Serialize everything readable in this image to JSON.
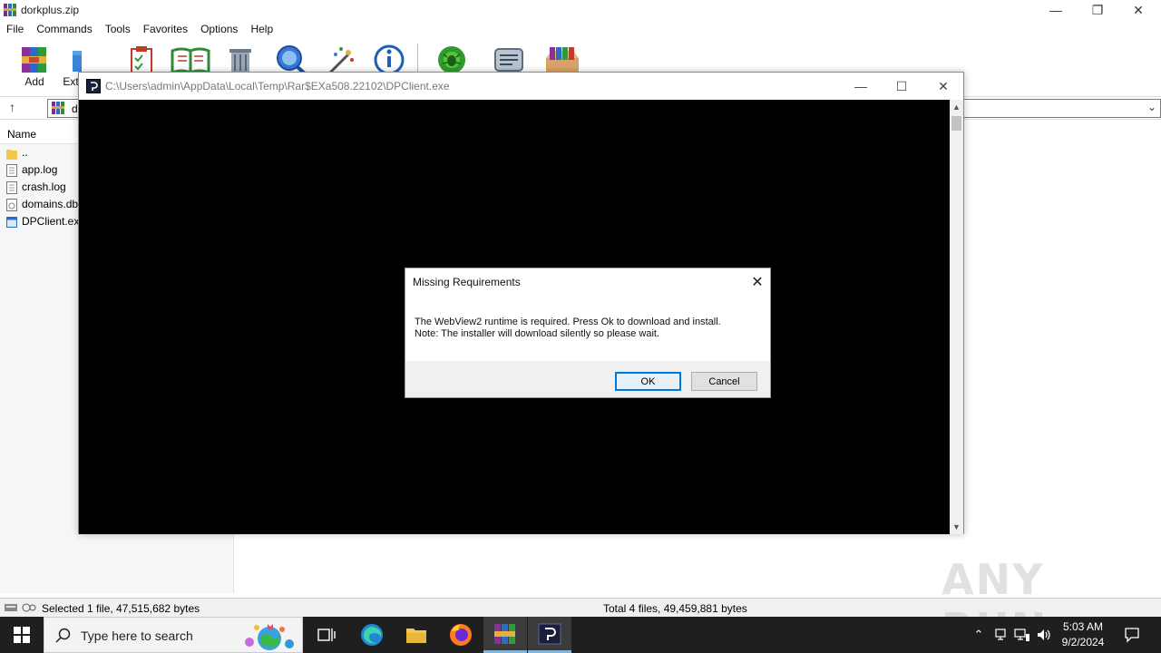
{
  "winrar": {
    "title": "dorkplus.zip",
    "menu": [
      "File",
      "Commands",
      "Tools",
      "Favorites",
      "Options",
      "Help"
    ],
    "toolbar": {
      "add_label": "Add",
      "extract_label": "Ext"
    },
    "address": {
      "text": "d"
    },
    "file_list": {
      "header": "Name",
      "items": [
        "..",
        "app.log",
        "crash.log",
        "domains.db",
        "DPClient.ex"
      ]
    },
    "status": {
      "selected": "Selected 1 file, 47,515,682 bytes",
      "total": "Total 4 files, 49,459,881 bytes"
    }
  },
  "console": {
    "title": "C:\\Users\\admin\\AppData\\Local\\Temp\\Rar$EXa508.22102\\DPClient.exe"
  },
  "dialog": {
    "title": "Missing Requirements",
    "line1": "The WebView2 runtime is required. Press Ok to download and install.",
    "line2": "Note: The installer will download silently so please wait.",
    "ok_label": "OK",
    "cancel_label": "Cancel"
  },
  "watermark": "ANY RUN",
  "taskbar": {
    "search_placeholder": "Type here to search",
    "time": "5:03 AM",
    "date": "9/2/2024"
  },
  "colors": {
    "accent": "#0078d7",
    "taskbar_bg": "#1f1f1f",
    "console_bg": "#000000"
  }
}
